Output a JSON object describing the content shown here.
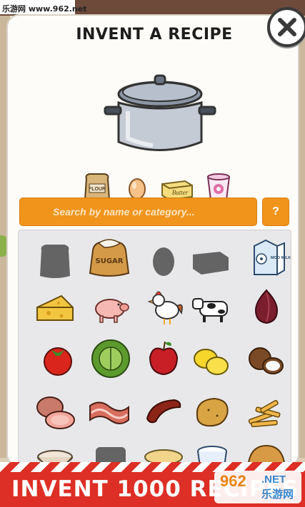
{
  "watermark": {
    "text": "乐游网 www.962.net"
  },
  "dialog": {
    "title": "INVENT A RECIPE",
    "search_placeholder": "Search by name or category...",
    "help_label": "?"
  },
  "starter_ingredients": [
    {
      "name": "flour-bag-icon",
      "label": "FLOUR"
    },
    {
      "name": "egg-icon"
    },
    {
      "name": "butter-icon",
      "label": "Butter"
    },
    {
      "name": "yogurt-icon"
    }
  ],
  "grid_items": [
    "flour-slot-empty-icon",
    "sugar-bag-icon",
    "egg-slot-empty-icon",
    "butter-slot-empty-icon",
    "milk-carton-icon",
    "cheese-icon",
    "pig-icon",
    "chicken-icon",
    "cow-icon",
    "red-onion-icon",
    "tomato-icon",
    "cabbage-icon",
    "apple-icon",
    "lemon-icon",
    "coconut-icon",
    "ham-icon",
    "bacon-icon",
    "sausage-icon",
    "potato-icon",
    "fries-icon",
    "bowl-icon",
    "pot-slot-icon",
    "soup-icon",
    "yogurt-cup-icon",
    "bread-icon"
  ],
  "sugar_label": "SUGAR",
  "milk_label": "MOO MILK",
  "banner": {
    "text": "INVENT 1000 RECIPES"
  },
  "logo": {
    "num": "962",
    "net": ".NET",
    "cn": "乐游网"
  },
  "colors": {
    "accent": "#f0941c",
    "banner": "#dd2f25"
  }
}
